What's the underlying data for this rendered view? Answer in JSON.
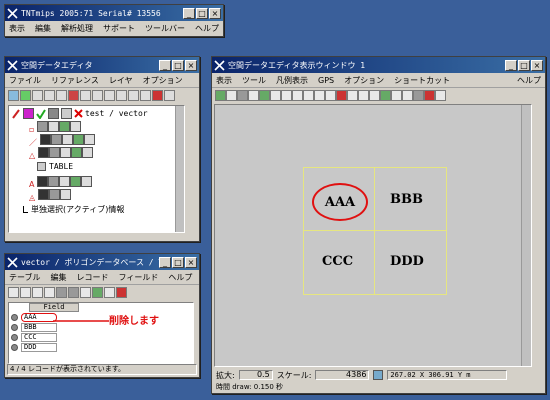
{
  "main_window": {
    "title": "TNTmips 2005:71  Serial# 13556",
    "menu": [
      "表示",
      "編集",
      "解析処理",
      "サポート",
      "ツールバー",
      "ヘルプ"
    ]
  },
  "editor_window": {
    "title": "空間データエディタ",
    "menu": [
      "ファイル",
      "リファレンス",
      "レイヤ",
      "オプション"
    ],
    "layer_path": "test / vector",
    "table_label": "TABLE",
    "mode_text": "単独選択(アクティブ)情報"
  },
  "table_window": {
    "title": "vector / ポリゴンデータベース / TABLE",
    "menu": [
      "テーブル",
      "編集",
      "レコード",
      "フィールド",
      "ヘルプ"
    ],
    "column_header": "Field",
    "rows": [
      "AAA",
      "BBB",
      "CCC",
      "DDD"
    ],
    "annotation": "削除します",
    "status": "4 / 4 レコードが表示されています。"
  },
  "view_window": {
    "title": "空間データエディタ表示ウィンドウ 1",
    "menu": [
      "表示",
      "ツール",
      "凡例表示",
      "GPS",
      "オプション",
      "ショートカット"
    ],
    "menu_help": "ヘルプ",
    "cells": [
      "AAA",
      "BBB",
      "CCC",
      "DDD"
    ],
    "zoom_label": "拡大:",
    "zoom_value": "0.5",
    "scale_label": "スケール:",
    "scale_value": "4386",
    "coords": "267.02 X 306.91 Y m",
    "time_label": "時間  draw: 0.150 秒"
  },
  "colors": {
    "desktop": "#3a5f9a",
    "titlebar": "#0a246a",
    "highlight_red": "#e01010",
    "annotation_red": "#e01010",
    "panel": "#d4d0c8",
    "map_bg": "#c8c8c8",
    "polygon_border": "#e6e680"
  }
}
